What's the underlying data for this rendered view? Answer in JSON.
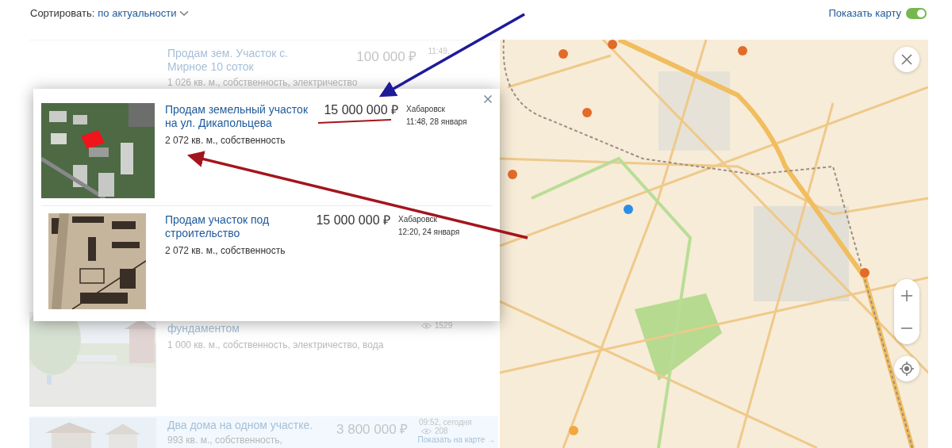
{
  "sort": {
    "label": "Сортировать:",
    "value": "по актуальности"
  },
  "map_toggle": {
    "label": "Показать карту",
    "on": true
  },
  "listings": [
    {
      "title": "Продам зем. Участок с. Мирное 10 соток",
      "price": "100 000 ₽",
      "time": "11:49,",
      "details": "1 026 кв. м., собственность, электричество"
    },
    {
      "title": "фундаментом",
      "views": "1529",
      "details": "1 000 кв. м., собственность, электричество, вода"
    },
    {
      "title": "Два дома на одном участке.",
      "price": "3 800 000 ₽",
      "time": "09:52, сегодня",
      "views": "208",
      "details": "993 кв. м., собственность,",
      "link": "Показать на карте →"
    }
  ],
  "popup": {
    "items": [
      {
        "title": "Продам земельный участок на ул. Дикапольцева",
        "price": "15 000 000 ₽",
        "city": "Хабаровск",
        "time": "11:48, 28 января",
        "details": "2 072 кв. м., собственность"
      },
      {
        "title": "Продам участок под строительство",
        "price": "15 000 000 ₽",
        "city": "Хабаровск",
        "time": "12:20, 24 января",
        "details": "2 072 кв. м., собственность"
      }
    ]
  }
}
